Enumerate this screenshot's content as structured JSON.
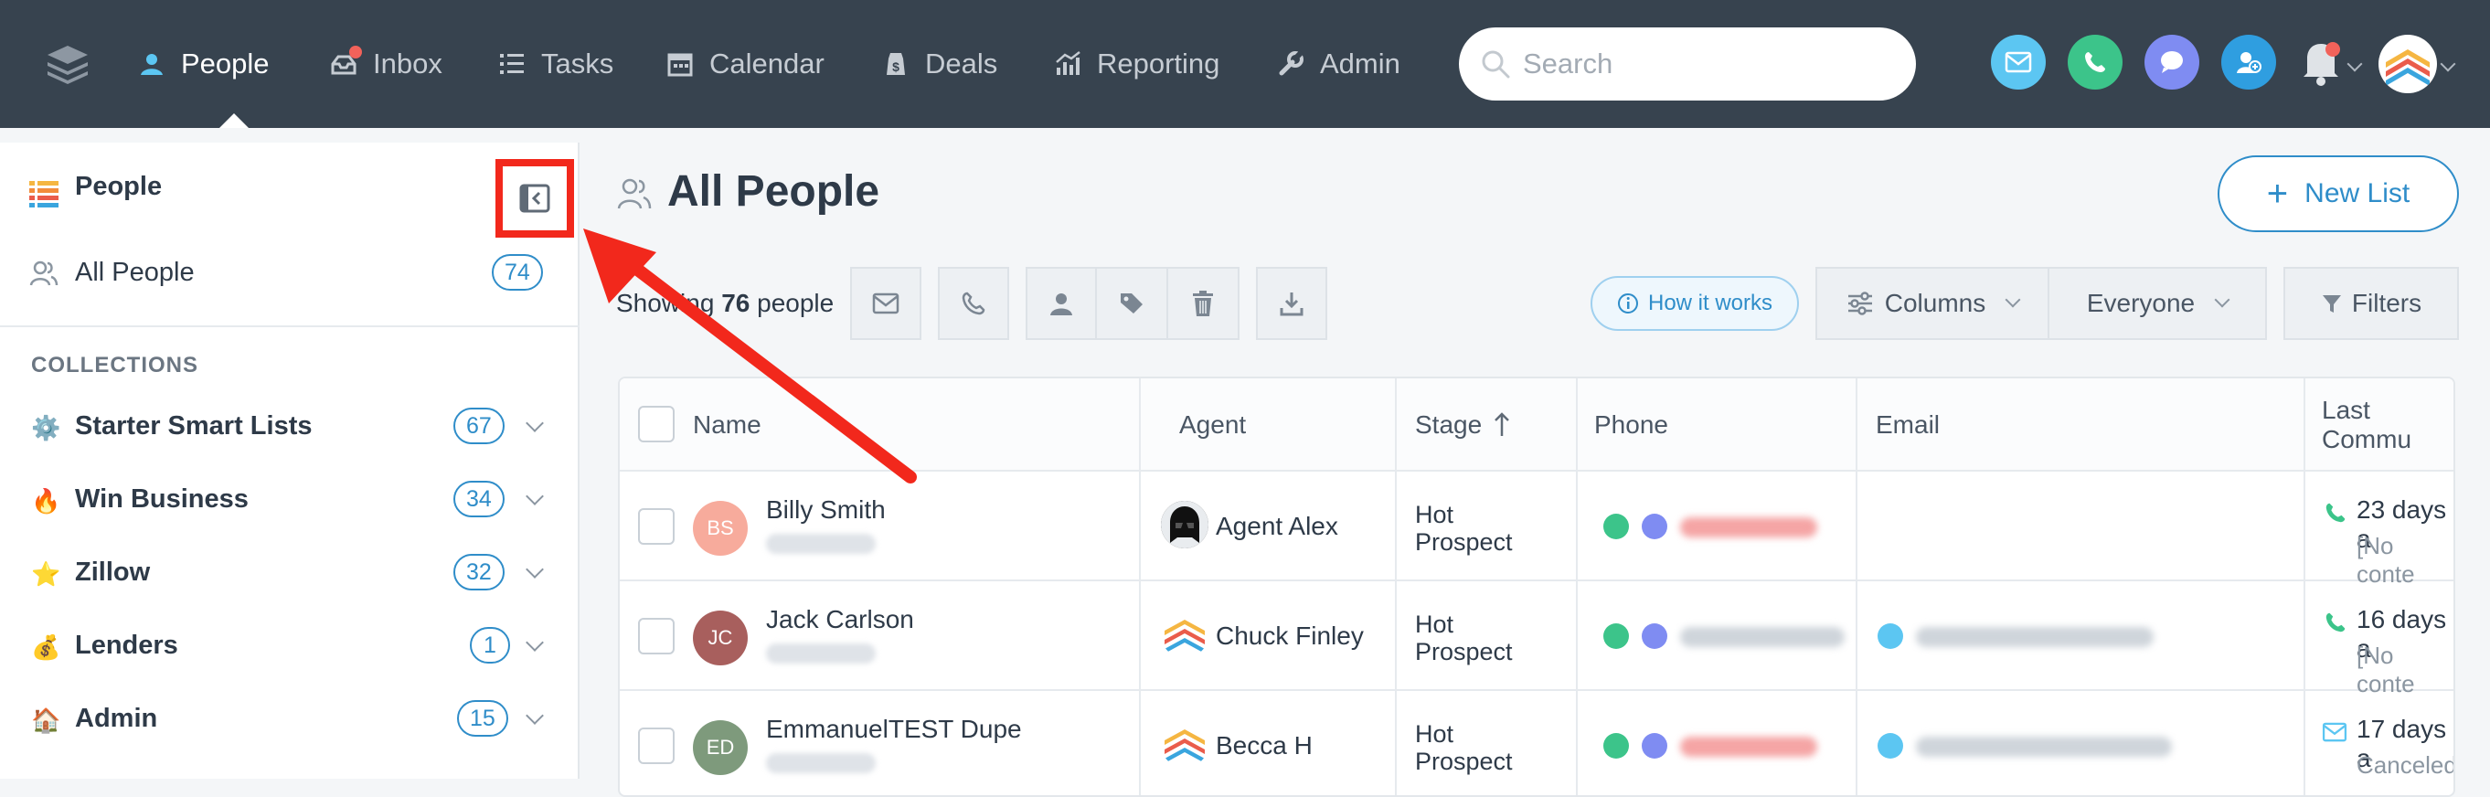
{
  "nav": {
    "items": [
      {
        "label": "People",
        "icon": "person-icon",
        "active": true
      },
      {
        "label": "Inbox",
        "icon": "inbox-icon",
        "active": false
      },
      {
        "label": "Tasks",
        "icon": "tasks-icon",
        "active": false
      },
      {
        "label": "Calendar",
        "icon": "calendar-icon",
        "active": false
      },
      {
        "label": "Deals",
        "icon": "deals-icon",
        "active": false
      },
      {
        "label": "Reporting",
        "icon": "reporting-icon",
        "active": false
      },
      {
        "label": "Admin",
        "icon": "wrench-icon",
        "active": false
      }
    ],
    "search_placeholder": "Search",
    "colors": {
      "bar": "#37434f",
      "email": "#5cc6f2",
      "call": "#3cc48a",
      "chat": "#7f8cf2",
      "add_contact": "#2f9ee0"
    }
  },
  "sidebar": {
    "title": "People",
    "all_people": {
      "label": "All People",
      "count": "74"
    },
    "section_label": "COLLECTIONS",
    "collections": [
      {
        "emoji": "⚙️",
        "label": "Starter Smart Lists",
        "count": "67"
      },
      {
        "emoji": "🔥",
        "label": "Win Business",
        "count": "34"
      },
      {
        "emoji": "⭐",
        "label": "Zillow",
        "count": "32"
      },
      {
        "emoji": "💰",
        "label": "Lenders",
        "count": "1"
      },
      {
        "emoji": "🏠",
        "label": "Admin",
        "count": "15"
      }
    ]
  },
  "main": {
    "title": "All People",
    "new_list_label": "New List",
    "showing_prefix": "Showing",
    "showing_count": "76",
    "showing_suffix": "people",
    "how_it_works": "How it works",
    "columns_label": "Columns",
    "everyone_label": "Everyone",
    "filters_label": "Filters"
  },
  "table": {
    "headers": {
      "name": "Name",
      "agent": "Agent",
      "stage": "Stage",
      "phone": "Phone",
      "email": "Email",
      "last_comm": "Last Commu"
    },
    "rows": [
      {
        "initials": "BS",
        "avatar_color": "#f7ab9c",
        "name": "Billy Smith",
        "agent": "Agent Alex",
        "stage_line1": "Hot",
        "stage_line2": "Prospect",
        "last_comm": "23 days a",
        "last_comm_sub": "[No conte",
        "comm_icon": "phone-icon"
      },
      {
        "initials": "JC",
        "avatar_color": "#a85f5d",
        "name": "Jack Carlson",
        "agent": "Chuck Finley",
        "stage_line1": "Hot",
        "stage_line2": "Prospect",
        "last_comm": "16 days a",
        "last_comm_sub": "[No conte",
        "comm_icon": "phone-icon"
      },
      {
        "initials": "ED",
        "avatar_color": "#7e9a7c",
        "name": "EmmanuelTEST Dupe",
        "agent": "Becca H",
        "stage_line1": "Hot",
        "stage_line2": "Prospect",
        "last_comm": "17 days a",
        "last_comm_sub": "Canceled",
        "comm_icon": "email-icon"
      }
    ]
  }
}
